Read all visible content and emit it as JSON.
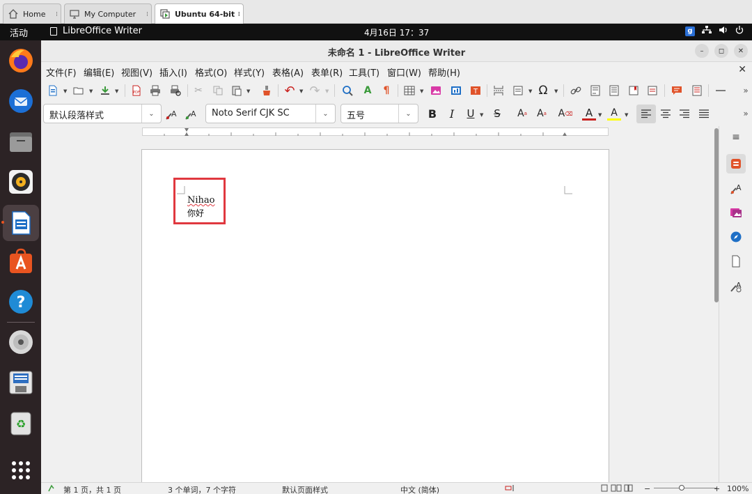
{
  "vm_tabs": [
    {
      "label": "Home",
      "icon": "home-icon"
    },
    {
      "label": "My Computer",
      "icon": "monitor-icon"
    },
    {
      "label": "Ubuntu 64-bit",
      "icon": "vm-icon",
      "active": true
    }
  ],
  "topbar": {
    "activities": "活动",
    "app_name": "LibreOffice Writer",
    "clock": "4月16日  17：37"
  },
  "window": {
    "title": "未命名 1 - LibreOffice Writer"
  },
  "menu": [
    "文件(F)",
    "编辑(E)",
    "视图(V)",
    "插入(I)",
    "格式(O)",
    "样式(Y)",
    "表格(A)",
    "表单(R)",
    "工具(T)",
    "窗口(W)",
    "帮助(H)"
  ],
  "formatting": {
    "paragraph_style": "默认段落样式",
    "font_name": "Noto Serif CJK SC",
    "font_size": "五号"
  },
  "document": {
    "lines": [
      "Nihao",
      "你好"
    ]
  },
  "status": {
    "page": "第 1 页，共 1 页",
    "words": "3 个单词，7 个字符",
    "page_style": "默认页面样式",
    "language": "中文 (简体)",
    "zoom": "100%"
  },
  "colors": {
    "accent": "#e95420",
    "selection_border": "#e0383f",
    "font_color": "#c9211e",
    "highlight": "#ffff00"
  }
}
